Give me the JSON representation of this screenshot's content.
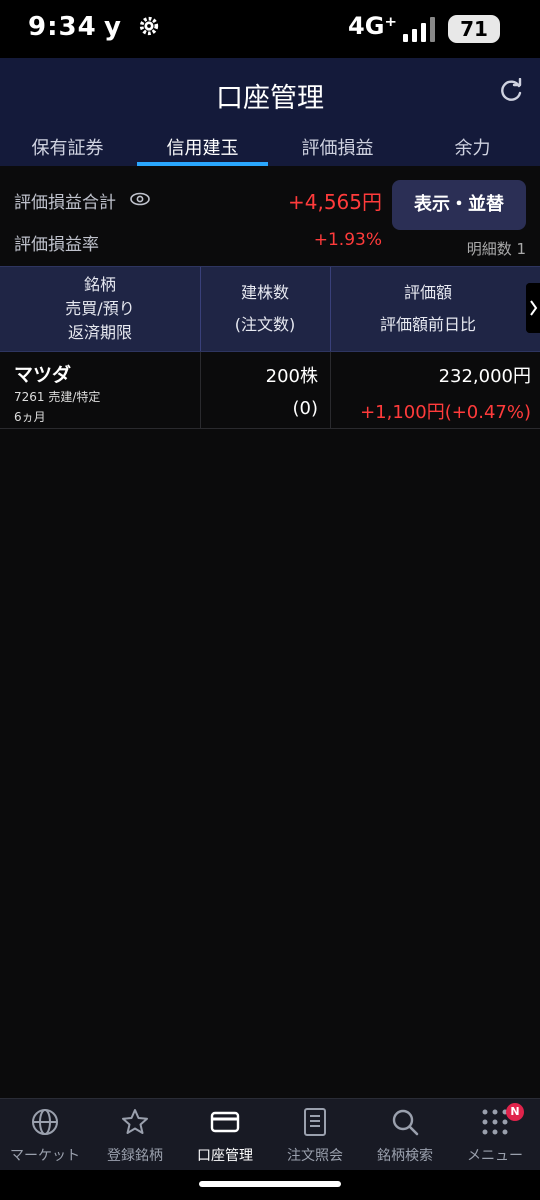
{
  "status": {
    "time": "9:34",
    "carrier_icon": "y",
    "network": "4G⁺",
    "battery": "71"
  },
  "header": {
    "title": "口座管理",
    "tabs": [
      "保有証券",
      "信用建玉",
      "評価損益",
      "余力"
    ],
    "active_tab": "信用建玉"
  },
  "summary": {
    "total_label": "評価損益合計",
    "total_value": "+4,565円",
    "rate_label": "評価損益率",
    "rate_value": "+1.93%",
    "button": "表示・並替",
    "count_label": "明細数 1"
  },
  "table": {
    "col1": [
      "銘柄",
      "売買/預り",
      "返済期限"
    ],
    "col2": [
      "建株数",
      "(注文数)"
    ],
    "col3": [
      "評価額",
      "評価額前日比"
    ],
    "rows": [
      {
        "name": "マツダ",
        "code": "7261 売建/特定",
        "deadline": "6ヵ月",
        "qty": "200株",
        "order_qty": "(0)",
        "amount": "232,000円",
        "diff": "+1,100円(+0.47%)"
      }
    ]
  },
  "nav": [
    {
      "label": "マーケット",
      "icon": "globe-icon"
    },
    {
      "label": "登録銘柄",
      "icon": "star-icon"
    },
    {
      "label": "口座管理",
      "icon": "card-icon"
    },
    {
      "label": "注文照会",
      "icon": "document-icon"
    },
    {
      "label": "銘柄検索",
      "icon": "search-icon"
    },
    {
      "label": "メニュー",
      "icon": "grid-icon",
      "badge": "N"
    }
  ],
  "colors": {
    "accent": "#2aa7ff",
    "positive": "#ff3b3b",
    "header_bg": "#141a3a"
  }
}
